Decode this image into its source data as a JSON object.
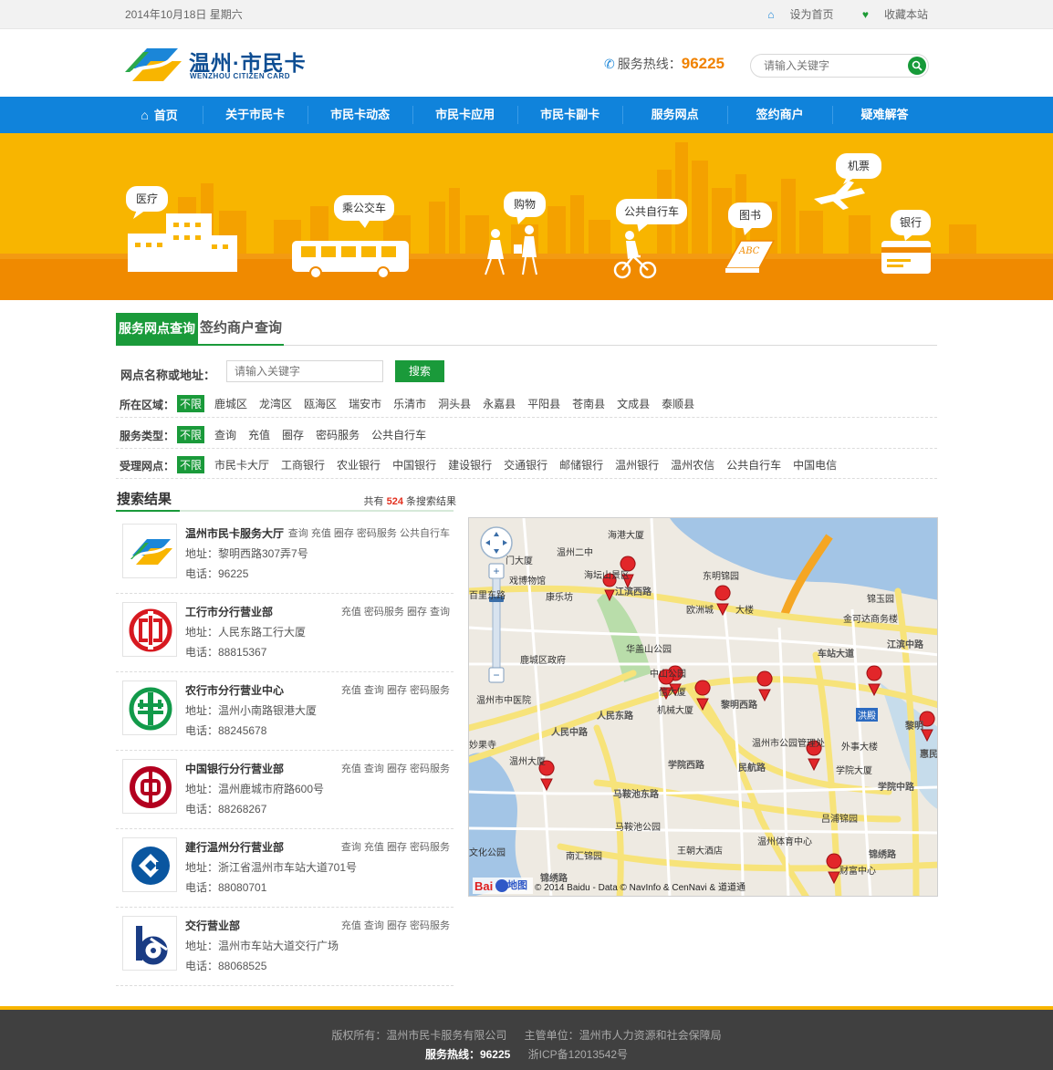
{
  "topbar": {
    "date": "2014年10月18日 星期六",
    "set_home": "设为首页",
    "bookmark": "收藏本站"
  },
  "header": {
    "logo_cn": "温州·市民卡",
    "logo_en": "WENZHOU CITIZEN CARD",
    "hotline_label": "服务热线：",
    "hotline_number": "96225",
    "search_placeholder": "请输入关键字"
  },
  "nav": [
    "首页",
    "关于市民卡",
    "市民卡动态",
    "市民卡应用",
    "市民卡副卡",
    "服务网点",
    "签约商户",
    "疑难解答"
  ],
  "banner": [
    "医疗",
    "乘公交车",
    "购物",
    "公共自行车",
    "图书",
    "机票",
    "银行"
  ],
  "tabs": {
    "active": "服务网点查询",
    "inactive": "签约商户查询"
  },
  "query": {
    "label": "网点名称或地址：",
    "placeholder": "请输入关键字",
    "button": "搜索"
  },
  "filters": {
    "region": {
      "label": "所在区域：",
      "options": [
        "不限",
        "鹿城区",
        "龙湾区",
        "瓯海区",
        "瑞安市",
        "乐清市",
        "洞头县",
        "永嘉县",
        "平阳县",
        "苍南县",
        "文成县",
        "泰顺县"
      ]
    },
    "service": {
      "label": "服务类型：",
      "options": [
        "不限",
        "查询",
        "充值",
        "圈存",
        "密码服务",
        "公共自行车"
      ]
    },
    "outlet": {
      "label": "受理网点：",
      "options": [
        "不限",
        "市民卡大厅",
        "工商银行",
        "农业银行",
        "中国银行",
        "建设银行",
        "交通银行",
        "邮储银行",
        "温州银行",
        "温州农信",
        "公共自行车",
        "中国电信"
      ]
    }
  },
  "results": {
    "title": "搜索结果",
    "count_prefix": "共有 ",
    "count": "524",
    "count_suffix": " 条搜索结果",
    "items": [
      {
        "name": "温州市民卡服务大厅",
        "services": "查询 充值 圈存 密码服务 公共自行车",
        "address": "地址：黎明西路307弄7号",
        "phone": "电话：96225"
      },
      {
        "name": "工行市分行营业部",
        "services": "充值 密码服务 圈存 查询",
        "address": "地址：人民东路工行大厦",
        "phone": "电话：88815367"
      },
      {
        "name": "农行市分行营业中心",
        "services": "充值 查询 圈存 密码服务",
        "address": "地址：温州小南路银港大厦",
        "phone": "电话：88245678"
      },
      {
        "name": "中国银行分行营业部",
        "services": "充值 查询 圈存 密码服务",
        "address": "地址：温州鹿城市府路600号",
        "phone": "电话：88268267"
      },
      {
        "name": "建行温州分行营业部",
        "services": "查询 充值 圈存 密码服务",
        "address": "地址：浙江省温州市车站大道701号",
        "phone": "电话：88080701"
      },
      {
        "name": "交行营业部",
        "services": "充值 查询 圈存 密码服务",
        "address": "地址：温州市车站大道交行广场",
        "phone": "电话：88068525"
      }
    ]
  },
  "map": {
    "places": [
      "海港大厦",
      "温州二中",
      "门大厦",
      "海坛山景区",
      "东明锦园",
      "戏博物馆",
      "江滨西路",
      "百里东路",
      "康乐坊",
      "欧洲城",
      "大楼",
      "锦玉园",
      "金可达商务楼",
      "江滨中路",
      "华盖山公园",
      "车站大道",
      "鹿城区政府",
      "中山公园",
      "信大厦",
      "机械大厦",
      "黎明西路",
      "洪殿",
      "黎明",
      "温州市中医院",
      "人民中路",
      "人民东路",
      "温州市公园管理处",
      "外事大楼",
      "妙果寺",
      "温州大厦",
      "学院大厦",
      "学院西路",
      "民航路",
      "学院中路",
      "惠民路",
      "马鞍池东路",
      "马鞍池公园",
      "吕浦锦园",
      "文化公园",
      "温州体育中心",
      "南汇锦园",
      "王朝大酒店",
      "锦绣路",
      "财富中心",
      "锦绣路"
    ],
    "baidu": "地图",
    "copyright": "© 2014 Baidu - Data © NavInfo & CenNavi & 道道通"
  },
  "footer": {
    "copyright": "版权所有：温州市民卡服务有限公司",
    "supervisor": "主管单位：温州市人力资源和社会保障局",
    "hotline": "服务热线：96225",
    "icp": "浙ICP备12013542号"
  }
}
